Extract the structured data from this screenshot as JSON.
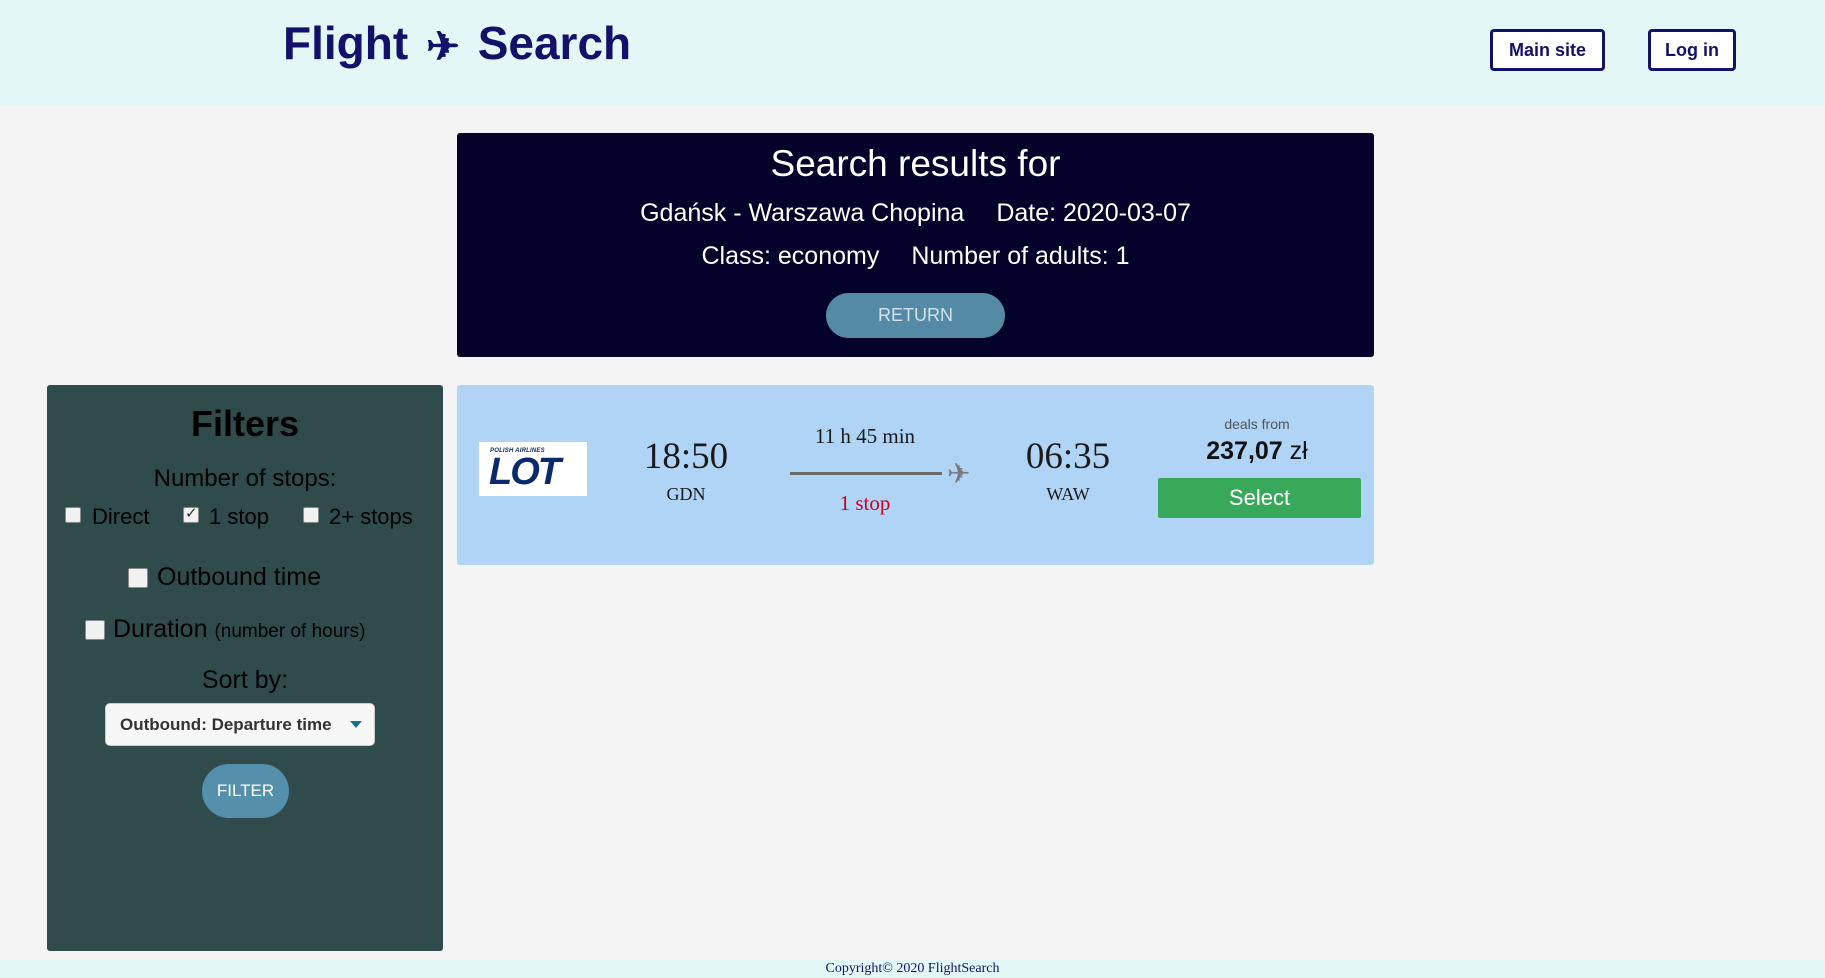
{
  "header": {
    "brand_left": "Flight",
    "brand_icon": "✈",
    "brand_right": "Search",
    "main_site_label": "Main site",
    "login_label": "Log in"
  },
  "summary": {
    "title": "Search results for",
    "route": "Gdańsk - Warszawa Chopina",
    "date": "Date: 2020-03-07",
    "class": "Class: economy",
    "adults": "Number of adults: 1",
    "return_label": "RETURN"
  },
  "filters": {
    "title": "Filters",
    "stops_label": "Number of stops:",
    "stop_options": [
      {
        "label": "Direct",
        "checked": false
      },
      {
        "label": "1 stop",
        "checked": true
      },
      {
        "label": "2+ stops",
        "checked": false
      }
    ],
    "outbound_label": "Outbound time",
    "outbound_checked": false,
    "duration_label": "Duration",
    "duration_note": "(number of hours)",
    "duration_checked": false,
    "sort_label": "Sort by:",
    "sort_value": "Outbound: Departure time",
    "filter_label": "FILTER"
  },
  "results": [
    {
      "airline_tag": "POLISH AIRLINES",
      "airline_logo_text": "LOT",
      "depart_time": "18:50",
      "depart_code": "GDN",
      "duration": "11 h 45 min",
      "stops": "1 stop",
      "arrive_time": "06:35",
      "arrive_code": "WAW",
      "deals_label": "deals from",
      "price_amount": "237,07",
      "price_currency": "zł",
      "select_label": "Select"
    }
  ],
  "footer": {
    "copyright": "Copyright© 2020 FlightSearch"
  },
  "colors": {
    "brand": "#14116a",
    "header_bg": "#e3f8f6",
    "summary_bg": "#04022a",
    "filters_bg": "#2f4b4b",
    "card_bg": "#b0d4f6",
    "select_btn": "#38a85a",
    "stops_red": "#c8001e"
  }
}
